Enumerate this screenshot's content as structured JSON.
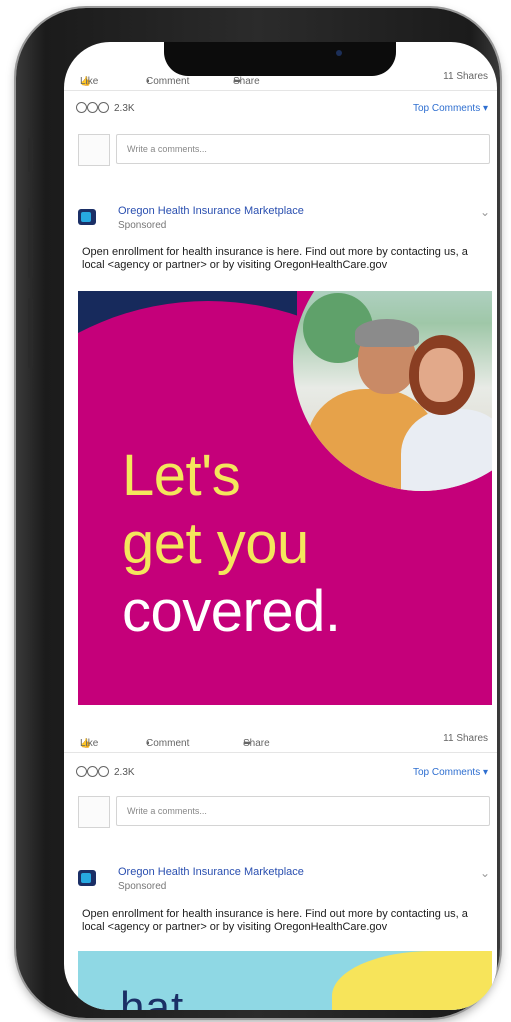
{
  "post1": {
    "actions": {
      "like": "Like",
      "comment": "Comment",
      "share": "Share",
      "shares": "11 Shares"
    },
    "reactions": {
      "count": "2.3K",
      "top_comments": "Top Comments ▾"
    },
    "comment_placeholder": "Write a comments..."
  },
  "post2": {
    "page_name": "Oregon Health Insurance Marketplace",
    "sponsored": "Sponsored",
    "text": "Open enrollment for health insurance is here. Find out more by contacting us, a local <agency or partner> or by visiting OregonHealthCare.gov",
    "ad": {
      "line1": "Let's",
      "line2": "get you",
      "line3": "covered."
    },
    "actions": {
      "like": "Like",
      "comment": "Comment",
      "share": "Share",
      "shares": "11 Shares"
    },
    "reactions": {
      "count": "2.3K",
      "top_comments": "Top Comments ▾"
    },
    "comment_placeholder": "Write a comments..."
  },
  "post3": {
    "page_name": "Oregon Health Insurance Marketplace",
    "sponsored": "Sponsored",
    "text": "Open enrollment for health insurance is here. Find out more by contacting us, a local <agency or partner> or by visiting OregonHealthCare.gov",
    "ad_partial": "hat"
  },
  "colors": {
    "ad_magenta": "#c5007a",
    "ad_yellow": "#f4e65c",
    "link_blue": "#2f6fd0",
    "navy": "#172a5c"
  }
}
